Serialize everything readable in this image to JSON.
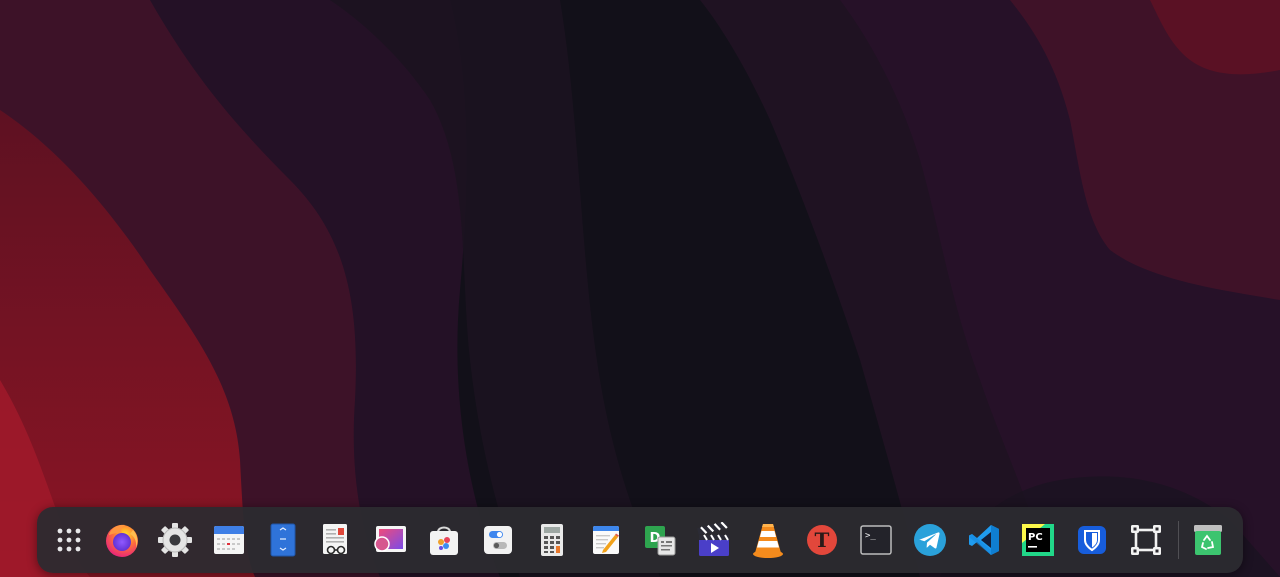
{
  "dock": {
    "apps": [
      {
        "id": "app-launcher",
        "icon": "grid-dots-icon"
      },
      {
        "id": "firefox",
        "icon": "firefox-icon"
      },
      {
        "id": "settings",
        "icon": "gear-icon"
      },
      {
        "id": "calendar",
        "icon": "calendar-icon"
      },
      {
        "id": "archive-manager",
        "icon": "archive-icon"
      },
      {
        "id": "document-viewer",
        "icon": "document-viewer-icon"
      },
      {
        "id": "image-viewer",
        "icon": "image-viewer-icon"
      },
      {
        "id": "app-store",
        "icon": "app-store-bag-icon"
      },
      {
        "id": "tweaks",
        "icon": "toggle-switches-icon"
      },
      {
        "id": "calculator",
        "icon": "calculator-icon"
      },
      {
        "id": "text-editor",
        "icon": "text-editor-icon"
      },
      {
        "id": "dictionary",
        "icon": "dictionary-icon"
      },
      {
        "id": "video-editor",
        "icon": "clapperboard-icon"
      },
      {
        "id": "vlc",
        "icon": "vlc-cone-icon"
      },
      {
        "id": "font-manager",
        "icon": "font-manager-icon"
      },
      {
        "id": "terminal",
        "icon": "terminal-icon"
      },
      {
        "id": "telegram",
        "icon": "telegram-icon"
      },
      {
        "id": "vscode",
        "icon": "vscode-icon"
      },
      {
        "id": "pycharm",
        "icon": "pycharm-icon"
      },
      {
        "id": "bitwarden",
        "icon": "bitwarden-shield-icon"
      },
      {
        "id": "screenshot-tool",
        "icon": "screenshot-frame-icon"
      }
    ],
    "trash": {
      "id": "trash",
      "icon": "recycle-bin-icon"
    },
    "glyphs": {
      "pycharm": "PC",
      "dictionary": "D",
      "terminal_prompt": ">_",
      "font_manager": "T"
    }
  },
  "colors": {
    "wallpaper_dark": "#121019",
    "wallpaper_purple": "#241126",
    "wallpaper_maroon": "#45122a",
    "wallpaper_red": "#7a1426",
    "dock_background": "#2c2a30",
    "firefox_orange": "#ff7139",
    "telegram_blue": "#2aa1da",
    "vscode_blue": "#1f9cf0",
    "pycharm_green": "#21d789",
    "bitwarden_blue": "#175ddc",
    "vlc_orange": "#f48b1d",
    "trash_green": "#3cc46f"
  }
}
